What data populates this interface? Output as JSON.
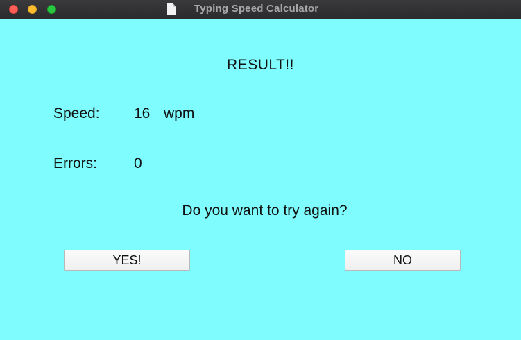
{
  "window": {
    "title": "Typing Speed Calculator",
    "icons": {
      "close": "close-icon",
      "minimize": "minimize-icon",
      "maximize": "maximize-icon",
      "document": "document-icon"
    }
  },
  "result": {
    "heading": "RESULT!!",
    "speed_label": "Speed:",
    "speed_value": "16",
    "speed_unit": "wpm",
    "errors_label": "Errors:",
    "errors_value": "0"
  },
  "prompt": {
    "question": "Do you want to try again?",
    "yes_label": "YES!",
    "no_label": "NO"
  },
  "colors": {
    "background": "#7ffcfd",
    "titlebar": "#2f2f31",
    "close": "#ff5f57",
    "minimize": "#febc2e",
    "maximize": "#28c840"
  }
}
